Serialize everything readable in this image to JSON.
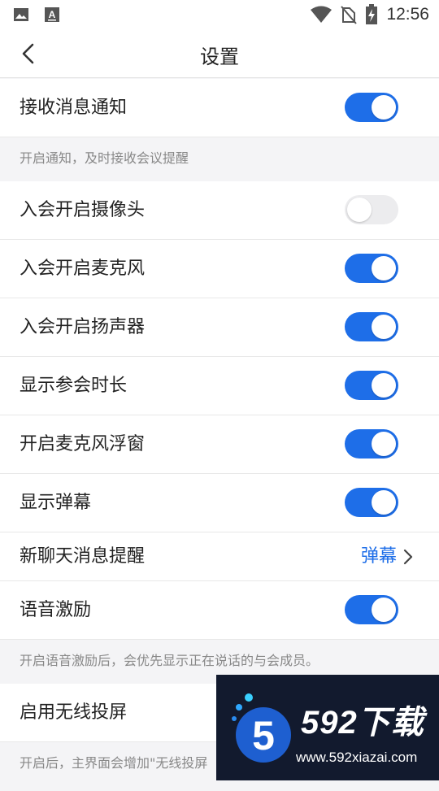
{
  "status": {
    "time": "12:56",
    "icons": [
      "image-icon",
      "font-icon",
      "wifi-icon",
      "no-sim-icon",
      "battery-charging-icon"
    ]
  },
  "header": {
    "title": "设置",
    "back_icon": "back-chevron-icon"
  },
  "items": [
    {
      "label": "接收消息通知",
      "on": true
    },
    {
      "label": "入会开启摄像头",
      "on": false
    },
    {
      "label": "入会开启麦克风",
      "on": true
    },
    {
      "label": "入会开启扬声器",
      "on": true
    },
    {
      "label": "显示参会时长",
      "on": true
    },
    {
      "label": "开启麦克风浮窗",
      "on": true
    },
    {
      "label": "显示弹幕",
      "on": true
    },
    {
      "label": "新聊天消息提醒",
      "value": "弹幕"
    },
    {
      "label": "语音激励",
      "on": true
    },
    {
      "label": "启用无线投屏"
    }
  ],
  "notes": {
    "notify": "开启通知，及时接收会议提醒",
    "voice": "开启语音激励后，会优先显示正在说话的与会成员。",
    "cast": "开启后，主界面会增加\"无线投屏"
  },
  "colors": {
    "accent": "#1e6ee8",
    "toggle_off": "#ececee"
  },
  "watermark": {
    "brand": "592下载",
    "url": "www.592xiazai.com",
    "logo_digit": "5"
  }
}
